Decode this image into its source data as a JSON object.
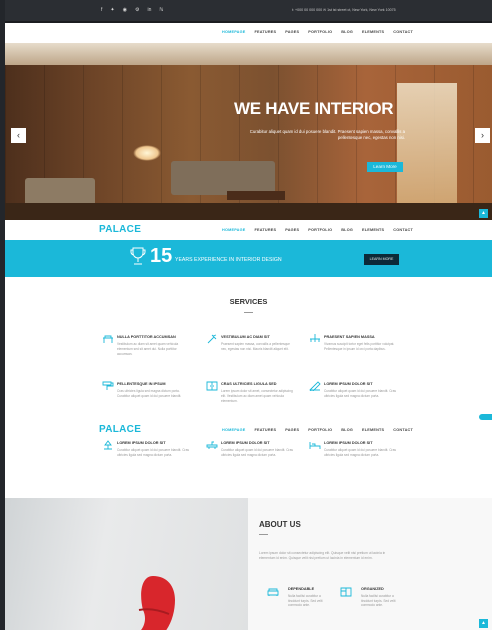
{
  "topbar": {
    "socials": [
      "f",
      "✦",
      "◉",
      "⚙",
      "in",
      "ℕ"
    ],
    "contact": "t: +000 00 000 000   ✉ 1st ist street ct, New York, New York 10075"
  },
  "nav": {
    "items": [
      "HOMEPAGE",
      "FEATURES",
      "PAGES",
      "PORTFOLIO",
      "BLOG",
      "ELEMENTS",
      "CONTACT"
    ]
  },
  "hero": {
    "title": "WE HAVE INTERIOR",
    "subtitle": "Curabitur aliquet quam id dui posuere blandit. Praesent sapien massa, convallis a pellentesque nec, egestas non nisi.",
    "button": "Learn More",
    "prev": "‹",
    "next": "›"
  },
  "sticky": {
    "logo": "PALACE",
    "items": [
      "HOMEPAGE",
      "FEATURES",
      "PAGES",
      "PORTFOLIO",
      "BLOG",
      "ELEMENTS",
      "CONTACT"
    ]
  },
  "band": {
    "number": "15",
    "text": "YEARS EXPERIENCE IN INTERIOR DESIGN",
    "button": "LEARN MORE"
  },
  "services": {
    "title": "SERVICES",
    "items": [
      {
        "icon": "lamp-icon",
        "title": "NULLA PORTTITOR ACCUMSAN",
        "desc": "Vestibulum ac diam sit amet quam vehicula elementum sed sit amet dui. Nulla porttitor accumsan."
      },
      {
        "icon": "hammer-icon",
        "title": "VESTIBULUM AC DIAM SIT",
        "desc": "Praesent sapien massa, convallis a pellentesque nec, egestas non nisi. Mauris blandit aliquet elit."
      },
      {
        "icon": "chandelier-icon",
        "title": "PRAESENT SAPIEN MASSA",
        "desc": "Vivamus suscipit tortor eget felis porttitor volutpat. Pellentesque in ipsum id orci porta dapibus."
      },
      {
        "icon": "paint-roller-icon",
        "title": "PELLENTESQUE IN IPSUM",
        "desc": "Cras ultricies ligula sed magna dictum porta. Curabitur aliquet quam id dui posuere blandit."
      },
      {
        "icon": "cabinet-icon",
        "title": "CRAS ULTRICIES LIGULA SED",
        "desc": "Lorem ipsum dolor sit amet, consectetur adipiscing elit. Vestibulum ac diam amet quam vehicula elementum."
      },
      {
        "icon": "pencil-ruler-icon",
        "title": "LOREM IPSUM DOLOR SIT",
        "desc": "Curabitur aliquet quam id dui posuere blandit. Cras ultricies ligula sed magna dictum porta."
      },
      {
        "icon": "desk-lamp-icon",
        "title": "LOREM IPSUM DOLOR SIT",
        "desc": "Curabitur aliquet quam id dui posuere blandit. Cras ultricies ligula sed magna dictum porta."
      },
      {
        "icon": "sink-icon",
        "title": "LOREM IPSUM DOLOR SIT",
        "desc": "Curabitur aliquet quam id dui posuere blandit. Cras ultricies ligula sed magna dictum porta."
      },
      {
        "icon": "bed-icon",
        "title": "LOREM IPSUM DOLOR SIT",
        "desc": "Curabitur aliquet quam id dui posuere blandit. Cras ultricies ligula sed magna dictum porta."
      }
    ]
  },
  "about": {
    "title": "ABOUT US",
    "text": "Lorem ipsum dolor sit consectetur adipiscing elit. Quisque velit nisi pretium ut lacinia in elementum id enim. Quisque velit nisi pretium ut lacinia in elementum id enim.",
    "features": [
      {
        "icon": "sofa-icon",
        "title": "DEPENDABLE",
        "desc": "Nulla facilisi curabitur a tincidunt turpis. Sed velit commodo ante."
      },
      {
        "icon": "blueprint-icon",
        "title": "ORGANIZED",
        "desc": "Nulla facilisi curabitur a tincidunt turpis. Sed velit commodo ante."
      }
    ]
  },
  "colors": {
    "accent": "#1bb8d9",
    "dark": "#2b2e33"
  }
}
